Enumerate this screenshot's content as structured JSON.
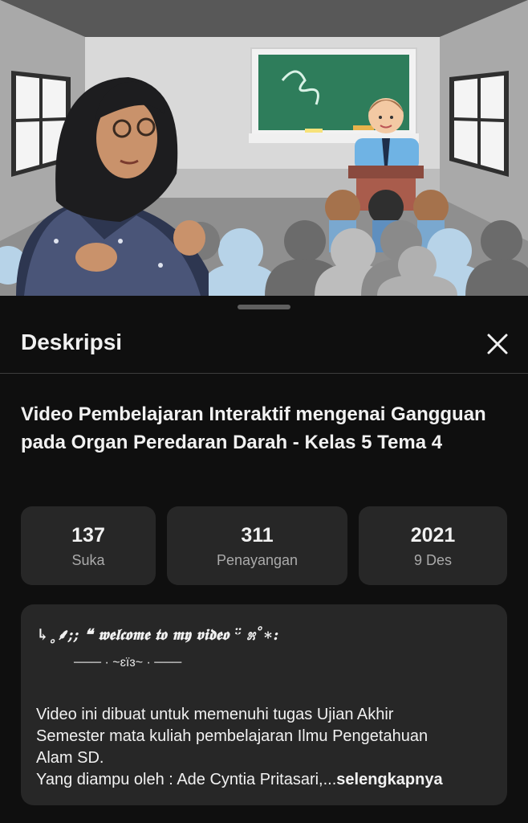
{
  "sheet": {
    "title": "Deskripsi",
    "close_icon": "close-icon"
  },
  "video": {
    "title": "Video Pembelajaran Interaktif mengenai Gangguan pada Organ Peredaran Darah - Kelas 5 Tema 4"
  },
  "stats": [
    {
      "value": "137",
      "label": "Suka"
    },
    {
      "value": "311",
      "label": "Penayangan"
    },
    {
      "value": "2021",
      "label": "9 Des"
    }
  ],
  "description": {
    "line1": "↳˳⸙;; ❝ 𝖜𝖊𝖑𝖈𝖔𝖒𝖊 𝖙𝖔 𝖒𝖞 𝖛𝖎𝖉𝖊𝖔 ᵕ̈ ೫˚∗:",
    "line2": "─── · ~ɛïɜ~ · ───",
    "body_lines": [
      "Video ini dibuat untuk memenuhi tugas Ujian Akhir",
      "Semester mata kuliah pembelajaran Ilmu Pengetahuan",
      "Alam SD.",
      "Yang diampu oleh : Ade Cyntia Pritasari,..."
    ],
    "more_label": "selengkapnya"
  },
  "colors": {
    "sheet_bg": "#0f0f0f",
    "card_bg": "#272727",
    "text_primary": "#f1f1f1",
    "text_secondary": "#aaaaaa",
    "chalkboard": "#2e7d5b"
  }
}
